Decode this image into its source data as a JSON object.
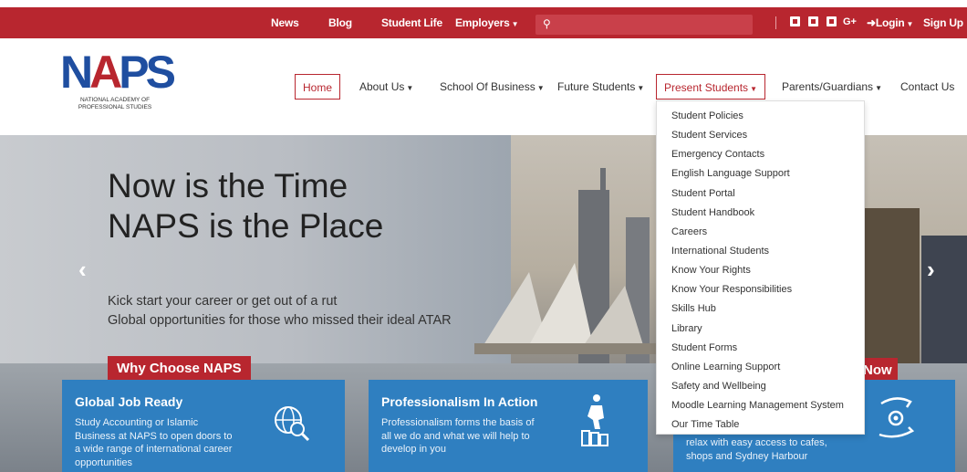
{
  "topbar": {
    "links": [
      "News",
      "Blog",
      "Student Life",
      "Employers"
    ],
    "social": [
      "f",
      "t",
      "in",
      "G+"
    ],
    "login": "Login",
    "signup": "Sign Up"
  },
  "logo": {
    "letters": "NAPS",
    "subtitle": "NATIONAL ACADEMY OF PROFESSIONAL STUDIES"
  },
  "nav": {
    "home": "Home",
    "about": "About Us",
    "school": "School Of Business",
    "future": "Future Students",
    "present": "Present Students",
    "parents": "Parents/Guardians",
    "contact": "Contact Us"
  },
  "hero": {
    "title_line1": "Now is the Time",
    "title_line2": "NAPS is the Place",
    "sub_line1": "Kick start your career or get out of a rut",
    "sub_line2": "Global opportunities for those who missed their ideal ATAR",
    "button": "Why Choose NAPS",
    "right_button": "Now"
  },
  "cards": [
    {
      "title": "Global Job Ready",
      "lines": [
        "Study Accounting or Islamic",
        "Business at NAPS to open doors to",
        "a wide range of international career",
        "opportunities"
      ]
    },
    {
      "title": "Professionalism In Action",
      "lines": [
        "Professionalism forms the basis of",
        "all we do and what we will help to",
        "develop in you"
      ]
    },
    {
      "title": "",
      "lines": [
        "relax with easy access to cafes,",
        "shops and Sydney Harbour"
      ]
    }
  ],
  "dropdown": {
    "items": [
      "Student Policies",
      "Student Services",
      "Emergency Contacts",
      "English Language Support",
      "Student Portal",
      "Student Handbook",
      "Careers",
      "International Students",
      "Know Your Rights",
      "Know Your Responsibilities",
      "Skills Hub",
      "Library",
      "Student Forms",
      "Online Learning Support",
      "Safety and Wellbeing",
      "Moodle Learning Management System",
      "Our Time Table"
    ]
  },
  "colors": {
    "brand_red": "#b8262f",
    "brand_blue": "#1f4ea0",
    "card_blue": "#2f7fc0"
  }
}
